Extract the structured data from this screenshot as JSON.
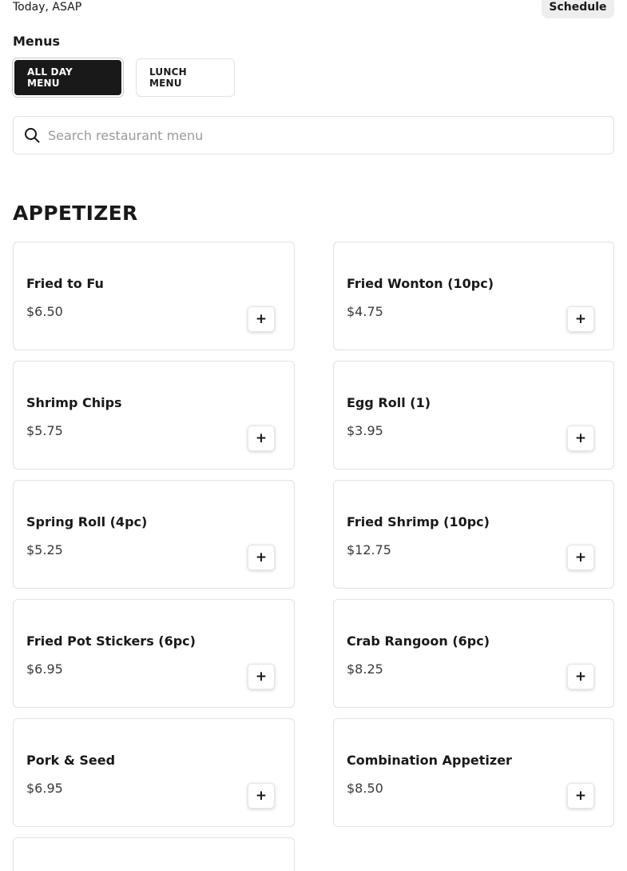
{
  "header": {
    "order_time": "Today, ASAP",
    "schedule_label": "Schedule"
  },
  "menus": {
    "heading": "Menus",
    "tabs": [
      {
        "label": "ALL DAY MENU",
        "active": true
      },
      {
        "label": "LUNCH MENU",
        "active": false
      }
    ]
  },
  "search": {
    "placeholder": "Search restaurant menu",
    "value": ""
  },
  "section": {
    "title": "APPETIZER",
    "add_label": "+",
    "items": [
      {
        "name": "Fried to Fu",
        "price": "$6.50"
      },
      {
        "name": "Fried Wonton (10pc)",
        "price": "$4.75"
      },
      {
        "name": "Shrimp Chips",
        "price": "$5.75"
      },
      {
        "name": "Egg Roll (1)",
        "price": "$3.95"
      },
      {
        "name": "Spring Roll (4pc)",
        "price": "$5.25"
      },
      {
        "name": "Fried Shrimp (10pc)",
        "price": "$12.75"
      },
      {
        "name": "Fried Pot Stickers (6pc)",
        "price": "$6.95"
      },
      {
        "name": "Crab Rangoon (6pc)",
        "price": "$8.25"
      },
      {
        "name": "Pork & Seed",
        "price": "$6.95"
      },
      {
        "name": "Combination Appetizer",
        "price": "$8.50"
      }
    ]
  },
  "colors": {
    "accent": "#191919",
    "border": "#e2e2e2",
    "muted_button": "#eeeeee"
  },
  "icons": {
    "search": "search-icon",
    "add": "plus-icon"
  }
}
